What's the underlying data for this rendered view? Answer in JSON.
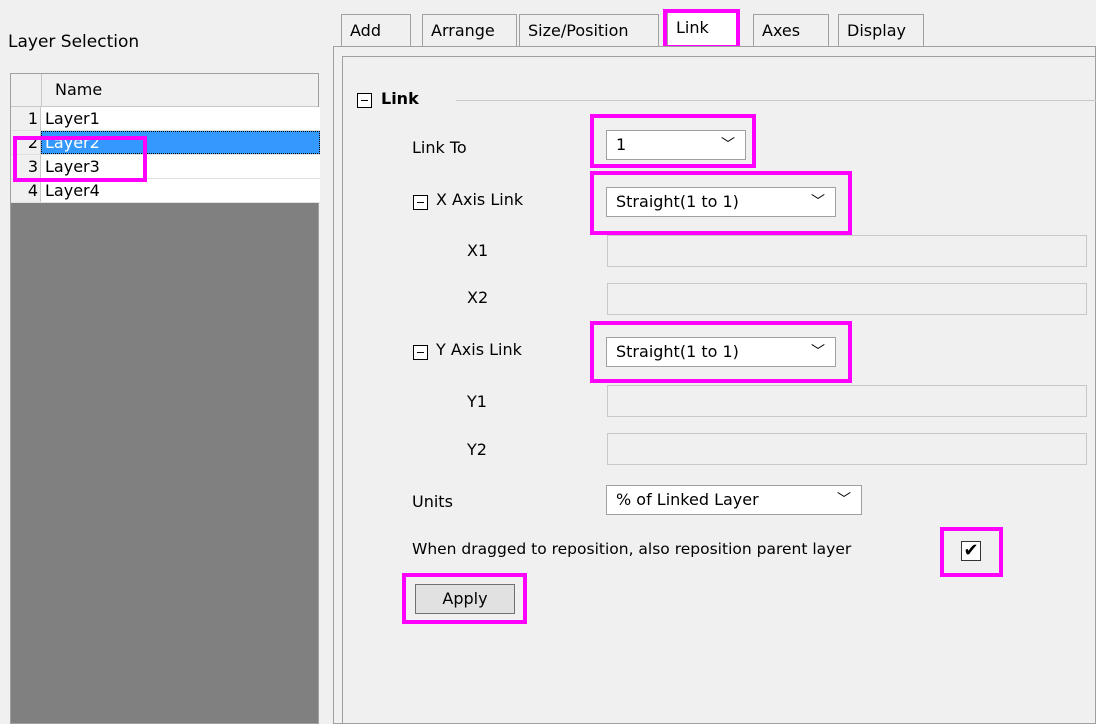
{
  "layer_selection": {
    "title": "Layer Selection",
    "column_header": "Name",
    "rows": [
      {
        "num": "1",
        "name": "Layer1"
      },
      {
        "num": "2",
        "name": "Layer2"
      },
      {
        "num": "3",
        "name": "Layer3"
      },
      {
        "num": "4",
        "name": "Layer4"
      }
    ],
    "selected_index": 1
  },
  "tabs": [
    "Add",
    "Arrange",
    "Size/Position",
    "Link",
    "Axes",
    "Display"
  ],
  "active_tab": "Link",
  "link": {
    "section_title": "Link",
    "link_to_label": "Link To",
    "link_to_value": "1",
    "x_axis_link_label": "X Axis Link",
    "x_axis_link_value": "Straight(1 to 1)",
    "x1_label": "X1",
    "x2_label": "X2",
    "y_axis_link_label": "Y Axis Link",
    "y_axis_link_value": "Straight(1 to 1)",
    "y1_label": "Y1",
    "y2_label": "Y2",
    "units_label": "Units",
    "units_value": "% of Linked Layer",
    "reposition_label": "When dragged to reposition, also reposition parent layer",
    "reposition_checked": true,
    "checkmark": "✔",
    "apply_label": "Apply"
  },
  "icons": {
    "dropdown_arrow": "﹀"
  },
  "colors": {
    "highlight": "#ff00ff",
    "selection": "#3399ff"
  }
}
